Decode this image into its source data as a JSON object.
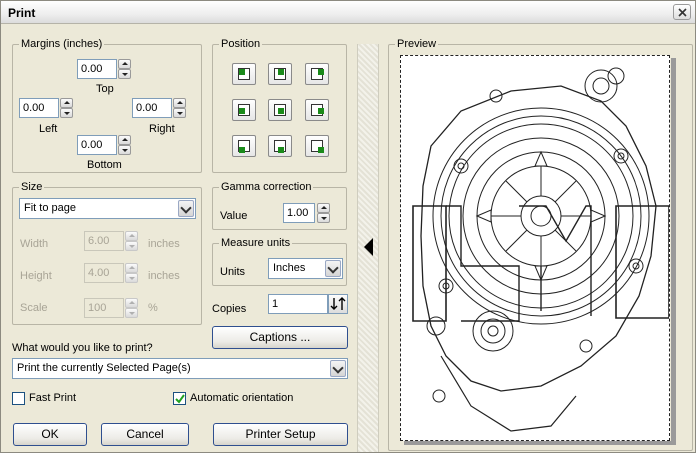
{
  "window": {
    "title": "Print"
  },
  "margins": {
    "legend": "Margins (inches)",
    "top": {
      "label": "Top",
      "value": "0.00"
    },
    "left": {
      "label": "Left",
      "value": "0.00"
    },
    "right": {
      "label": "Right",
      "value": "0.00"
    },
    "bottom": {
      "label": "Bottom",
      "value": "0.00"
    }
  },
  "position": {
    "legend": "Position",
    "buttons": [
      "top-left",
      "top-center",
      "top-right",
      "middle-left",
      "center",
      "middle-right",
      "bottom-left",
      "bottom-center",
      "bottom-right"
    ]
  },
  "size": {
    "legend": "Size",
    "mode": "Fit to page",
    "width": {
      "label": "Width",
      "value": "6.00",
      "unit": "inches"
    },
    "height": {
      "label": "Height",
      "value": "4.00",
      "unit": "inches"
    },
    "scale": {
      "label": "Scale",
      "value": "100",
      "unit": "%"
    }
  },
  "gamma": {
    "legend": "Gamma correction",
    "label": "Value",
    "value": "1.00"
  },
  "measure": {
    "legend": "Measure units",
    "label": "Units",
    "value": "Inches"
  },
  "copies": {
    "label": "Copies",
    "value": "1"
  },
  "captions_button": "Captions ...",
  "print_what": {
    "label": "What would you like to print?",
    "value": "Print the currently Selected Page(s)"
  },
  "fast_print": {
    "label": "Fast Print",
    "checked": false
  },
  "auto_orientation": {
    "label": "Automatic orientation",
    "checked": true
  },
  "buttons": {
    "ok": "OK",
    "cancel": "Cancel",
    "printer_setup": "Printer Setup"
  },
  "preview": {
    "legend": "Preview"
  }
}
